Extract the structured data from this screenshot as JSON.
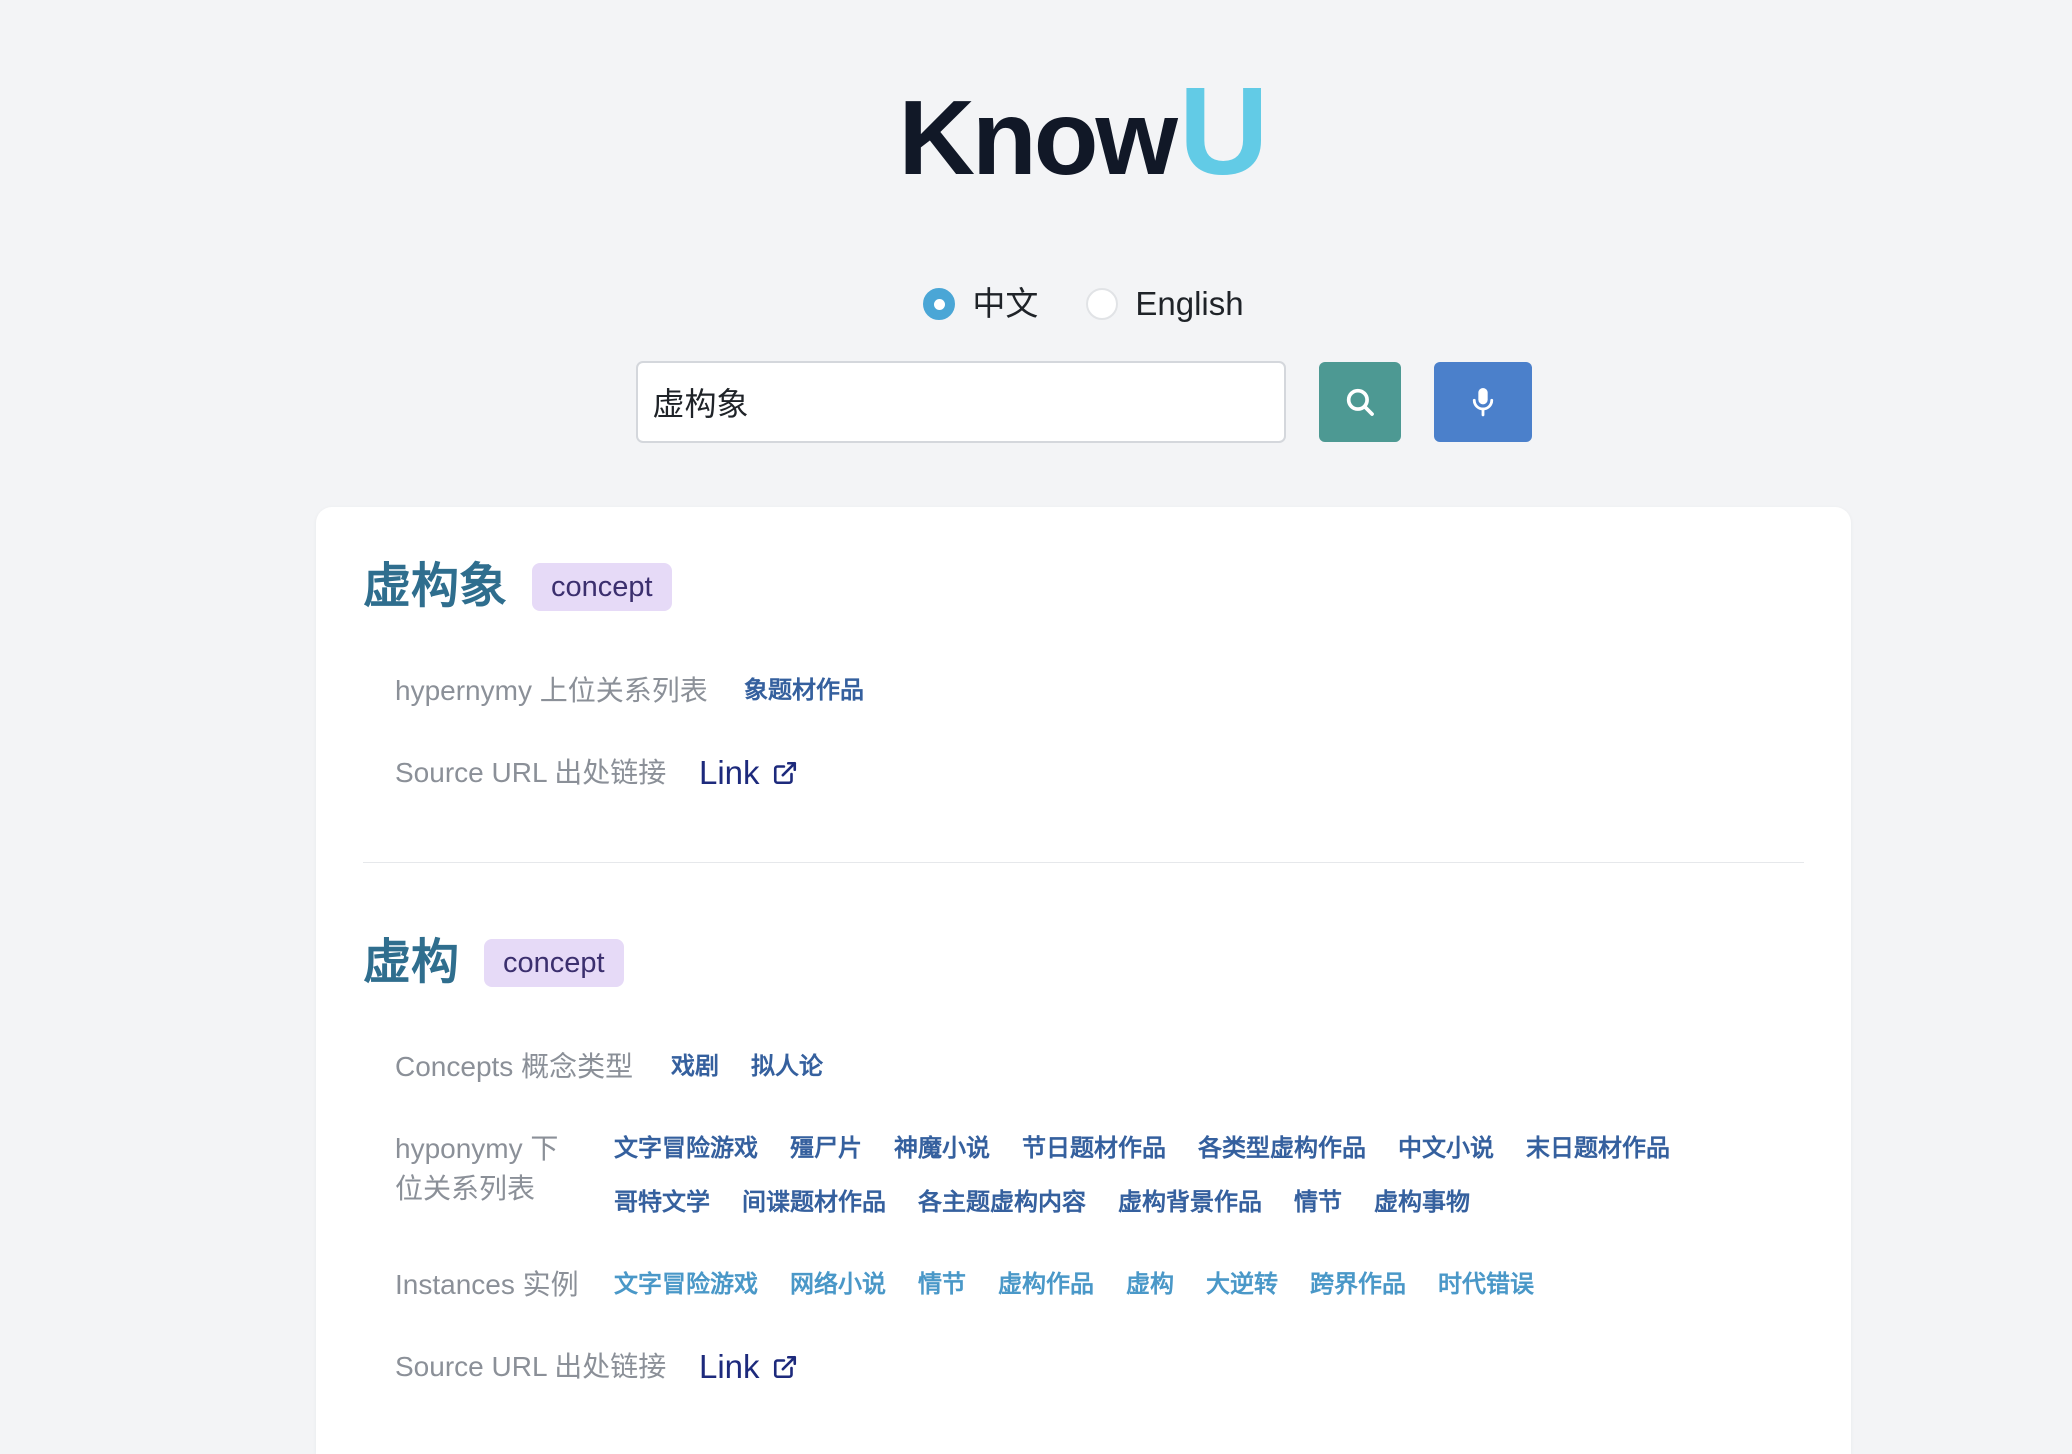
{
  "logo": {
    "know": "Know",
    "u": "U"
  },
  "language": {
    "options": [
      {
        "label": "中文",
        "selected": true
      },
      {
        "label": "English",
        "selected": false
      }
    ]
  },
  "search": {
    "value": "虚构象",
    "search_button_icon": "search-icon",
    "voice_button_icon": "microphone-icon"
  },
  "results": [
    {
      "title": "虚构象",
      "badge": "concept",
      "rows": [
        {
          "label": "hypernymy 上位关系列表",
          "values": [
            "象题材作品"
          ]
        },
        {
          "label": "Source URL 出处链接",
          "link": "Link",
          "link_icon": "external-link-icon"
        }
      ]
    },
    {
      "title": "虚构",
      "badge": "concept",
      "rows": [
        {
          "label": "Concepts 概念类型",
          "values": [
            "戏剧",
            "拟人论"
          ]
        },
        {
          "label": "hyponymy 下位关系列表",
          "values": [
            "文字冒险游戏",
            "殭尸片",
            "神魔小说",
            "节日题材作品",
            "各类型虚构作品",
            "中文小说",
            "末日题材作品",
            "哥特文学",
            "间谍题材作品",
            "各主题虚构内容",
            "虚构背景作品",
            "情节",
            "虚构事物"
          ]
        },
        {
          "label": "Instances 实例",
          "values": [
            "文字冒险游戏",
            "网络小说",
            "情节",
            "虚构作品",
            "虚构",
            "大逆转",
            "跨界作品",
            "时代错误"
          ]
        },
        {
          "label": "Source URL 出处链接",
          "link": "Link",
          "link_icon": "external-link-icon"
        }
      ]
    }
  ],
  "colors": {
    "page_bg": "#f3f4f6",
    "logo_dark": "#111827",
    "logo_accent": "#62cbe6",
    "radio_accent": "#4aa6d6",
    "search_button": "#4d9993",
    "voice_button": "#4b80cb",
    "title_color": "#2f6e8e",
    "badge_bg": "#e6daf7",
    "badge_text": "#3b2f6e",
    "label_color": "#8b9098",
    "tag_dark": "#35609e",
    "tag_light": "#4a98c8",
    "link_color": "#1d2a7c"
  }
}
